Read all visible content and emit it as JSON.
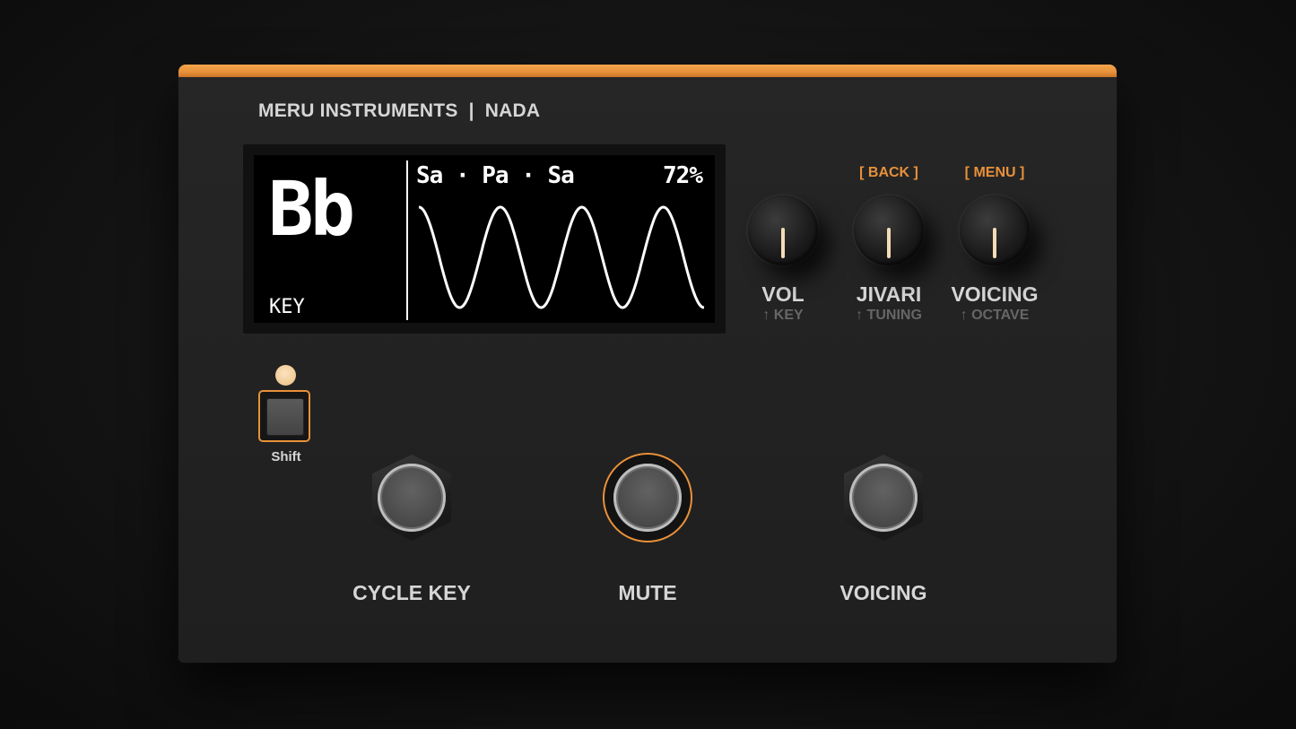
{
  "brand": "MERU INSTRUMENTS  |  NADA",
  "display": {
    "key_value": "Bb",
    "key_label": "KEY",
    "scale_name": "Sa · Pa · Sa",
    "level_pct": "72%"
  },
  "knobs": [
    {
      "top_label": "",
      "label": "VOL",
      "sub_label": "↑ KEY"
    },
    {
      "top_label": "[ BACK ]",
      "label": "JIVARI",
      "sub_label": "↑ TUNING"
    },
    {
      "top_label": "[ MENU ]",
      "label": "VOICING",
      "sub_label": "↑ OCTAVE"
    }
  ],
  "shift": {
    "label": "Shift"
  },
  "footswitches": [
    {
      "label": "CYCLE KEY"
    },
    {
      "label": "MUTE"
    },
    {
      "label": "VOICING"
    }
  ],
  "colors": {
    "accent": "#e8913a",
    "panel": "#232323",
    "screen": "#000000",
    "text": "#d6d6d6"
  }
}
